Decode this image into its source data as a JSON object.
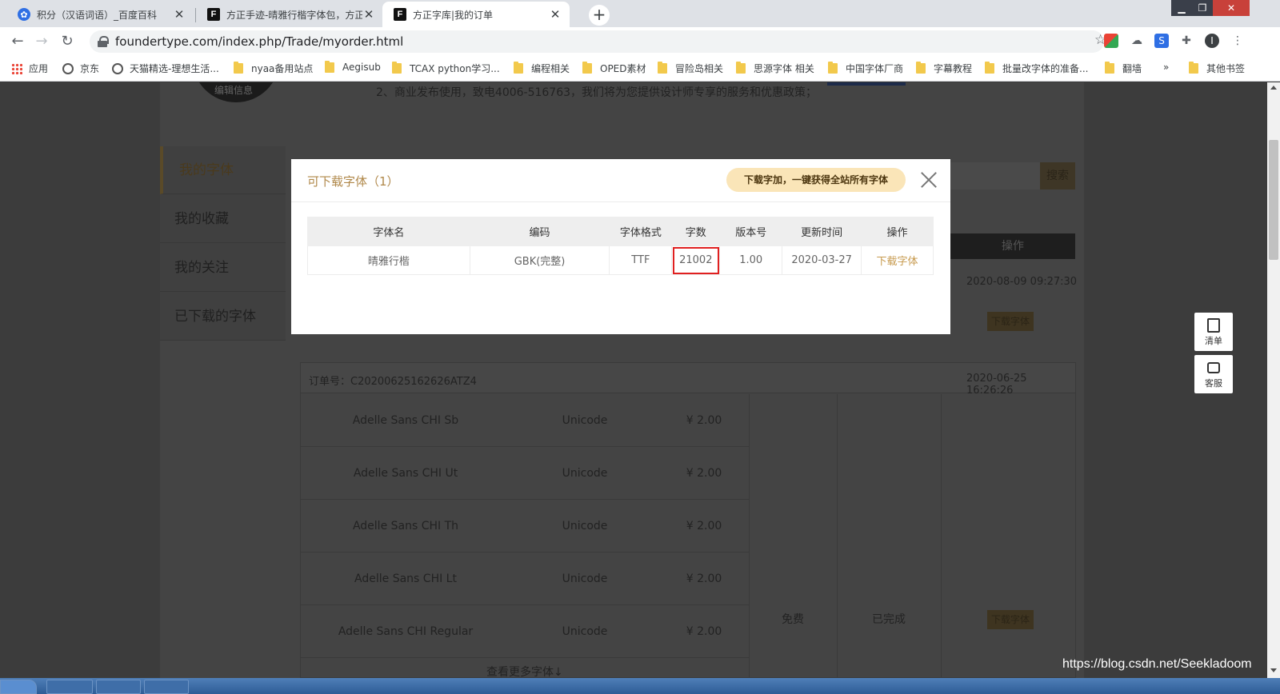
{
  "browser": {
    "tabs": [
      {
        "title": "积分（汉语词语）_百度百科",
        "favicon": "baidu-icon",
        "active": false
      },
      {
        "title": "方正手迹-晴雅行楷字体包，方正",
        "favicon": "foundertype-icon",
        "active": false
      },
      {
        "title": "方正字库|我的订单",
        "favicon": "foundertype-icon",
        "active": true
      }
    ],
    "url": "foundertype.com/index.php/Trade/myorder.html",
    "bookmarks": [
      "应用",
      "京东",
      "天猫精选-理想生活...",
      "nyaa备用站点",
      "Aegisub",
      "TCAX python学习...",
      "编程相关",
      "OPED素材",
      "冒险岛相关",
      "思源字体 相关",
      "中国字体厂商",
      "字幕教程",
      "批量改字体的准备...",
      "翻墙",
      "»",
      "其他书签"
    ]
  },
  "page": {
    "avatar_label": "编辑信息",
    "notice": "2、商业发布使用，致电4006-516763，我们将为您提供设计师专享的服务和优惠政策；",
    "side_menu": [
      "我的字体",
      "我的收藏",
      "我的关注",
      "已下载的字体"
    ],
    "search_button": "搜索",
    "table_action_header": "操作",
    "order1": {
      "date": "2020-08-09 09:27:30",
      "download_button": "下载字体"
    },
    "order2": {
      "number": "订单号：C20200625162626ATZ4",
      "date": "2020-06-25 16:26:26",
      "fonts": [
        {
          "name": "Adelle Sans CHI Sb",
          "encoding": "Unicode",
          "price": "¥ 2.00"
        },
        {
          "name": "Adelle Sans CHI Ut",
          "encoding": "Unicode",
          "price": "¥ 2.00"
        },
        {
          "name": "Adelle Sans CHI Th",
          "encoding": "Unicode",
          "price": "¥ 2.00"
        },
        {
          "name": "Adelle Sans CHI Lt",
          "encoding": "Unicode",
          "price": "¥ 2.00"
        },
        {
          "name": "Adelle Sans CHI Regular",
          "encoding": "Unicode",
          "price": "¥ 2.00"
        }
      ],
      "price_total": "免费",
      "status": "已完成",
      "download_button": "下载字体",
      "more_link": "查看更多字体↓"
    }
  },
  "floating": {
    "list_label": "清单",
    "service_label": "客服"
  },
  "modal": {
    "title": "可下载字体（1）",
    "promo": "下载字加，一键获得全站所有字体",
    "headers": [
      "字体名",
      "编码",
      "字体格式",
      "字数",
      "版本号",
      "更新时间",
      "操作"
    ],
    "row": {
      "name": "晴雅行楷",
      "encoding": "GBK(完整)",
      "format": "TTF",
      "count": "21002",
      "version": "1.00",
      "updated": "2020-03-27",
      "action": "下载字体"
    }
  },
  "watermark": "https://blog.csdn.net/Seekladoom",
  "colors": {
    "accent": "#b0884a",
    "promo_bg": "#fae5b8",
    "highlight": "#e02020"
  }
}
